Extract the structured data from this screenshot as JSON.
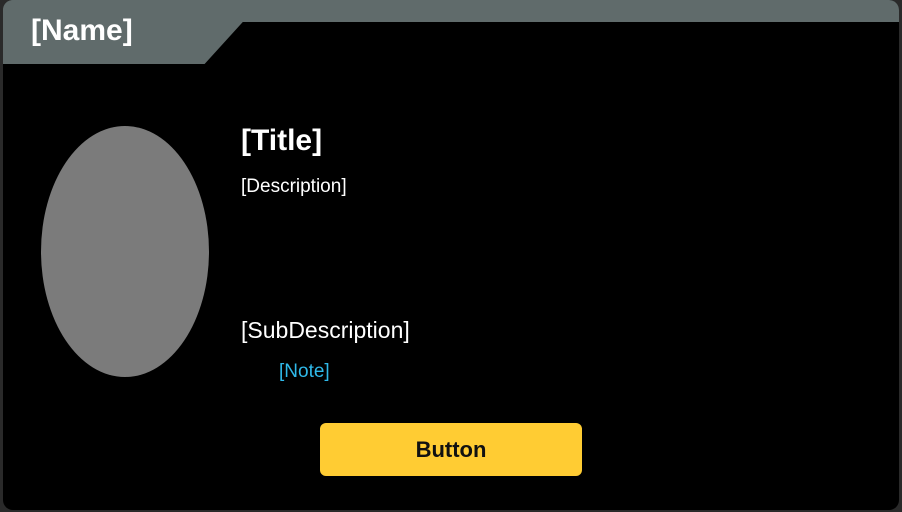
{
  "header": {
    "name": "[Name]"
  },
  "content": {
    "title": "[Title]",
    "description": "[Description]",
    "subdescription": "[SubDescription]",
    "note": "[Note]"
  },
  "actions": {
    "button_label": "Button"
  },
  "colors": {
    "card_background": "#000000",
    "header_background": "#606b6b",
    "avatar_placeholder": "#7b7b7b",
    "note_accent": "#2fb9e9",
    "button_background": "#ffcc33"
  }
}
